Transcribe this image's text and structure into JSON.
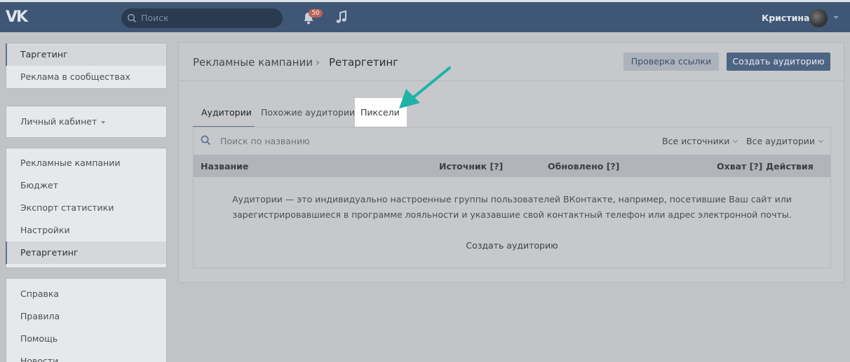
{
  "topbar": {
    "logo": "VK",
    "search_placeholder": "Поиск",
    "notifications_count": "50",
    "username": "Кристина"
  },
  "sidebar": {
    "groups": [
      {
        "items": [
          {
            "label": "Таргетинг",
            "active": true
          },
          {
            "label": "Реклама в сообществах"
          }
        ]
      },
      {
        "items": [
          {
            "label": "Личный кабинет",
            "dropdown": true
          }
        ]
      },
      {
        "items": [
          {
            "label": "Рекламные кампании"
          },
          {
            "label": "Бюджет"
          },
          {
            "label": "Экспорт статистики"
          },
          {
            "label": "Настройки"
          },
          {
            "label": "Ретаргетинг",
            "active": true
          }
        ]
      },
      {
        "items": [
          {
            "label": "Справка"
          },
          {
            "label": "Правила"
          },
          {
            "label": "Помощь"
          },
          {
            "label": "Новости"
          }
        ]
      }
    ]
  },
  "main": {
    "breadcrumb": {
      "parent": "Рекламные кампании",
      "separator": "›",
      "current": "Ретаргетинг"
    },
    "buttons": {
      "check_link": "Проверка ссылки",
      "create_audience": "Создать аудиторию"
    },
    "tabs": [
      {
        "label": "Аудитории",
        "active": true
      },
      {
        "label": "Похожие аудитории"
      },
      {
        "label": "Пиксели",
        "highlighted": true
      }
    ],
    "search_placeholder": "Поиск по названию",
    "filters": {
      "sources": "Все источники",
      "audiences": "Все аудитории"
    },
    "table": {
      "columns": [
        "Название",
        "Источник [?]",
        "Обновлено [?]",
        "Охват [?]",
        "Действия"
      ]
    },
    "empty_text_line1": "Аудитории — это индивидуально настроенные группы пользователей ВКонтакте, например, посетившие Ваш сайт или",
    "empty_text_line2": "зарегистрировавшиеся в программе лояльности и указавшие свой контактный телефон или адрес электронной почты.",
    "create_link": "Создать аудиторию"
  },
  "colors": {
    "accent": "#4d6583",
    "annotation_arrow": "#1fb3a8"
  }
}
